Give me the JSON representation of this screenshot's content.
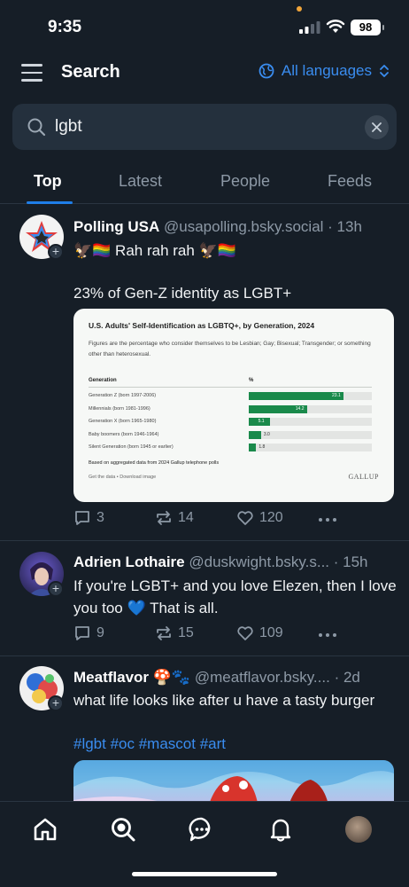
{
  "status_bar": {
    "time": "9:35",
    "battery": "98"
  },
  "header": {
    "title": "Search",
    "language_label": "All languages"
  },
  "search": {
    "query": "lgbt"
  },
  "tabs": [
    {
      "label": "Top",
      "active": true
    },
    {
      "label": "Latest",
      "active": false
    },
    {
      "label": "People",
      "active": false
    },
    {
      "label": "Feeds",
      "active": false
    }
  ],
  "posts": [
    {
      "display_name": "Polling USA",
      "handle": "@usapolling.bsky.social",
      "time": "· 13h",
      "text_line1": "🦅🏳️‍🌈 Rah rah rah 🦅🏳️‍🌈",
      "text_line2": "23% of Gen-Z identity as LGBT+",
      "replies": "3",
      "reposts": "14",
      "likes": "120",
      "embed": {
        "title": "U.S. Adults' Self-Identification as LGBTQ+, by Generation, 2024",
        "subtitle": "Figures are the percentage who consider themselves to be Lesbian; Gay; Bisexual; Transgender; or something other than heterosexual.",
        "col_generation": "Generation",
        "col_percent": "%",
        "note": "Based on aggregated data from 2024 Gallup telephone polls",
        "links": "Get the data • Download image",
        "logo": "GALLUP"
      }
    },
    {
      "display_name": "Adrien Lothaire",
      "handle": "@duskwight.bsky.s...",
      "time": "· 15h",
      "text": "If you're LGBT+ and you love Elezen, then I love you too 💙 That is all.",
      "replies": "9",
      "reposts": "15",
      "likes": "109"
    },
    {
      "display_name": "Meatflavor 🍄🐾",
      "handle": "@meatflavor.bsky....",
      "time": "· 2d",
      "text": "what life looks like after u have a tasty burger",
      "tags": "#lgbt #oc #mascot #art"
    }
  ],
  "chart_data": {
    "type": "bar",
    "title": "U.S. Adults' Self-Identification as LGBTQ+, by Generation, 2024",
    "categories": [
      "Generation Z (born 1997-2006)",
      "Millennials (born 1981-1996)",
      "Generation X (born 1965-1980)",
      "Baby boomers (born 1946-1964)",
      "Silent Generation (born 1945 or earlier)"
    ],
    "values": [
      23.1,
      14.2,
      5.1,
      3.0,
      1.8
    ],
    "value_labels": [
      "23.1",
      "14.2",
      "5.1",
      "3.0",
      "1.8"
    ],
    "xlabel": "",
    "ylabel": "%",
    "xlim": [
      0,
      30
    ],
    "color": "#1a8a4b"
  },
  "colors": {
    "accent": "#3a8df0",
    "background": "#161e27",
    "chart_bar": "#1a8a4b"
  },
  "icons": [
    "menu-icon",
    "globe-icon",
    "chevron-updown-icon",
    "search-icon",
    "close-icon",
    "reply-icon",
    "repost-icon",
    "heart-icon",
    "more-icon",
    "home-icon",
    "search-nav-icon",
    "chat-icon",
    "bell-icon"
  ]
}
